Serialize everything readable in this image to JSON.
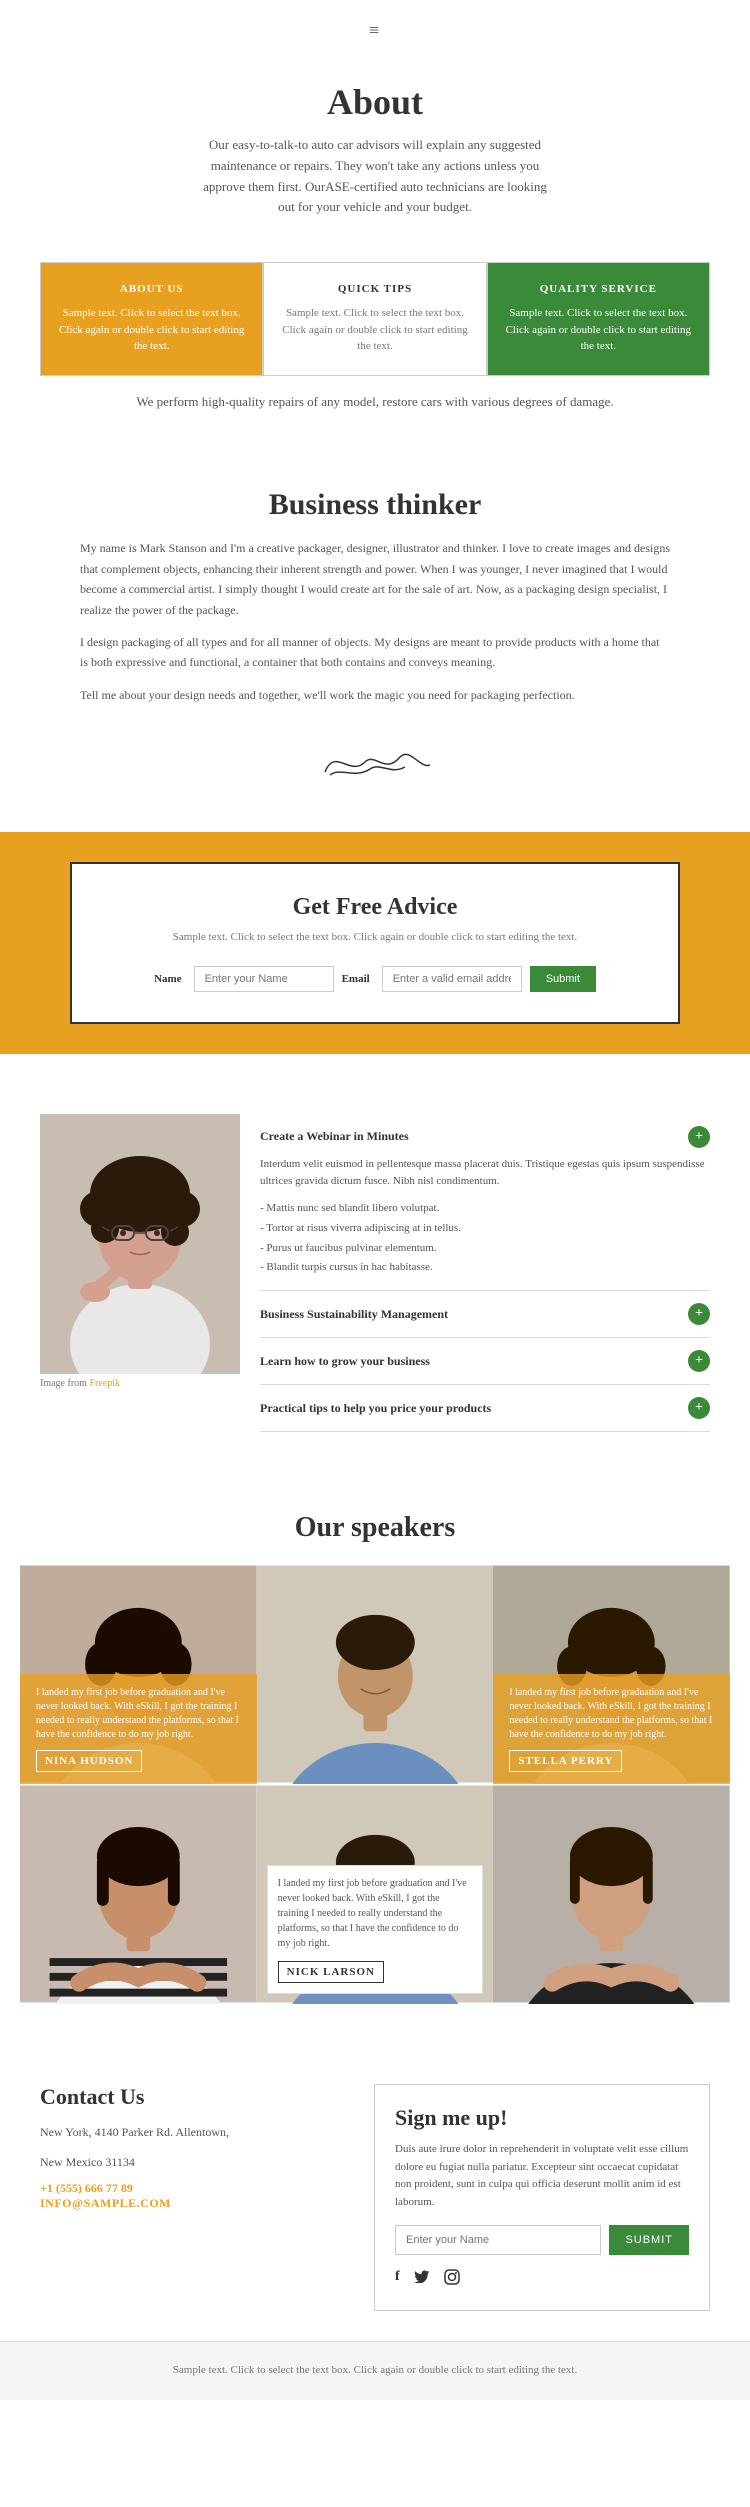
{
  "header": {
    "hamburger_icon": "≡"
  },
  "about": {
    "title": "About",
    "subtitle": "Our easy-to-talk-to auto car advisors will explain any suggested maintenance or repairs. They won't take any actions unless you approve them first. OurASE-certified auto technicians are looking out for your vehicle and your budget.",
    "cards": [
      {
        "id": "about-us",
        "title": "ABOUT US",
        "text": "Sample text. Click to select the text box. Click again or double click to start editing the text.",
        "type": "yellow"
      },
      {
        "id": "quick-tips",
        "title": "QUICK TIPS",
        "text": "Sample text. Click to select the text box. Click again or double click to start editing the text.",
        "type": "white"
      },
      {
        "id": "quality-service",
        "title": "QUALITY SERVICE",
        "text": "Sample text. Click to select the text box. Click again or double click to start editing the text.",
        "type": "green"
      }
    ],
    "footer_text": "We perform high-quality repairs of any model, restore cars with various degrees of damage."
  },
  "thinker": {
    "title": "Business thinker",
    "paragraphs": [
      "My name is Mark Stanson and I'm a creative packager, designer, illustrator and thinker. I love to create images and designs that complement objects, enhancing their inherent strength and power. When I was younger, I never imagined that I would become a commercial artist. I simply thought I would create art for the sale of art. Now, as a packaging design specialist, I realize the power of the package.",
      "I design packaging of all types and for all manner of objects. My designs are meant to provide products with a home that is both expressive and functional, a container that both contains and conveys meaning.",
      "Tell me about your design needs and together, we'll work the magic you need for packaging perfection."
    ],
    "signature": "✍"
  },
  "advice": {
    "title": "Get Free Advice",
    "subtitle": "Sample text. Click to select the text box. Click again or double click to start editing the text.",
    "form": {
      "name_label": "Name",
      "name_placeholder": "Enter your Name",
      "email_label": "Email",
      "email_placeholder": "Enter a valid email addre",
      "submit_label": "Submit"
    }
  },
  "webinar": {
    "image_credit": "Image from Freepik",
    "items": [
      {
        "title": "Create a Webinar in Minutes",
        "has_description": true,
        "description": "Interdum velit euismod in pellentesque massa placerat duis. Tristique egestas quis ipsum suspendisse ultrices gravida dictum fusce. Nibh nisl condimentum.",
        "list": [
          "Mattis nunc sed blandit libero volutpat.",
          "Tortor at risus viverra adipiscing at in tellus.",
          "Purus ut faucibus pulvinar elementum.",
          "Blandit turpis cursus in hac habitasse."
        ]
      },
      {
        "title": "Business Sustainability Management",
        "has_description": false
      },
      {
        "title": "Learn how to grow your business",
        "has_description": false
      },
      {
        "title": "Practical tips to help you price your products",
        "has_description": false
      }
    ]
  },
  "speakers": {
    "title": "Our speakers",
    "people": [
      {
        "name": "NINA HUDSON",
        "quote": "I landed my first job before graduation and I've never looked back. With eSkill, I got the training I needed to really understand the platforms, so that I have the confidence to do my job right.",
        "position": "top-left",
        "overlay": "yellow"
      },
      {
        "name": "",
        "quote": "",
        "position": "top-center",
        "overlay": "none"
      },
      {
        "name": "STELLA PERRY",
        "quote": "I landed my first job before graduation and I've never looked back. With eSkill, I got the training I needed to really understand the platforms, so that I have the confidence to do my job right.",
        "position": "top-right",
        "overlay": "orange"
      },
      {
        "name": "",
        "quote": "",
        "position": "bottom-left",
        "overlay": "none"
      },
      {
        "name": "NICK LARSON",
        "quote": "I landed my first job before graduation and I've never looked back. With eSkill, I got the training I needed to really understand the platforms, so that I have the confidence to do my job right.",
        "position": "bottom-center",
        "overlay": "box"
      },
      {
        "name": "",
        "quote": "",
        "position": "bottom-right",
        "overlay": "none"
      }
    ]
  },
  "contact": {
    "title": "Contact Us",
    "address_line1": "New York, 4140 Parker Rd. Allentown,",
    "address_line2": "New Mexico 31134",
    "phone": "+1 (555) 666 77 89",
    "email": "INFO@SAMPLE.COM"
  },
  "signup": {
    "title": "Sign me up!",
    "text": "Duis aute irure dolor in reprehenderit in voluptate velit esse cillum dolore eu fugiat nulla pariatur. Excepteur sint occaecat cupidatat non proident, sunt in culpa qui officia deserunt mollit anim id est laborum.",
    "placeholder": "Enter your Name",
    "submit_label": "SUBMIT",
    "social": {
      "facebook": "f",
      "twitter": "t",
      "instagram": "ig"
    }
  },
  "footer": {
    "text": "Sample text. Click to select the text box. Click again or double click to start editing the text."
  },
  "colors": {
    "yellow": "#e8a020",
    "green": "#3a8a3a",
    "dark": "#333333",
    "light_gray": "#f5f5f5",
    "medium_gray": "#777777"
  }
}
